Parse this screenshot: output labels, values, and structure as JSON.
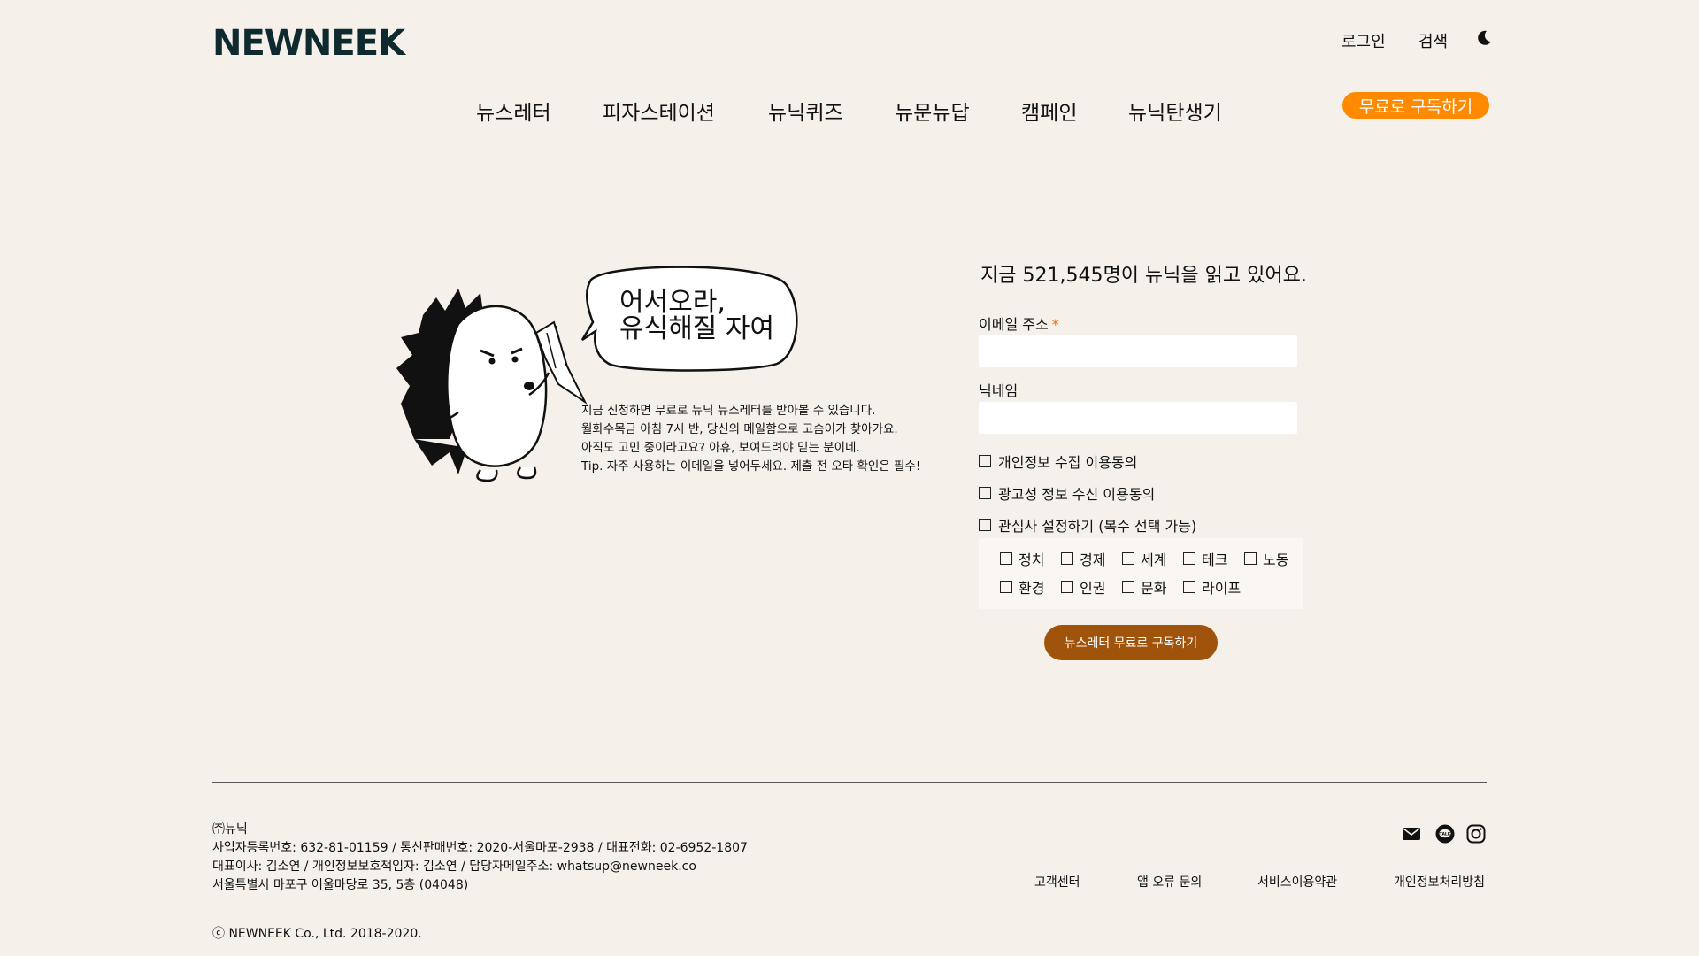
{
  "header": {
    "logo": "NEWNEEK",
    "login": "로그인",
    "search": "검색",
    "theme_icon": "moon-icon",
    "nav": [
      "뉴스레터",
      "피자스테이션",
      "뉴닉퀴즈",
      "뉴문뉴답",
      "캠페인",
      "뉴닉탄생기"
    ],
    "subscribe_button": "무료로 구독하기",
    "accent_color": "#ff8a00"
  },
  "hero": {
    "bubble_text": "어서오라,\n유식해질 자여",
    "intro": [
      "지금 신청하면 무료로 뉴닉 뉴스레터를 받아볼 수 있습니다.",
      "월화수목금 아침 7시 반, 당신의 메일함으로 고슴이가 찾아가요.",
      "아직도 고민 중이라고요? 아휴, 보여드려야 믿는 분이네.",
      "Tip. 자주 사용하는 이메일을 넣어두세요. 제출 전 오타 확인은 필수!"
    ]
  },
  "form": {
    "count_line": "지금  521,545명이 뉴닉을 읽고 있어요.",
    "email_label": "이메일 주소",
    "required_mark": "*",
    "email_value": "",
    "nickname_label": "닉네임",
    "nickname_value": "",
    "privacy_consent": "개인정보 수집 이용동의",
    "ad_consent": "광고성 정보 수신 이용동의",
    "interest_setting": "관심사 설정하기 (복수 선택 가능)",
    "interests": [
      "정치",
      "경제",
      "세계",
      "테크",
      "노동",
      "환경",
      "인권",
      "문화",
      "라이프"
    ],
    "submit": "뉴스레터 무료로 구독하기",
    "submit_color": "#a0540b"
  },
  "footer": {
    "company": "㈜뉴닉",
    "line1": "사업자등록번호: 632-81-01159   /   통신판매번호: 2020-서울마포-2938   /   대표전화: 02-6952-1807",
    "line2": "대표이사: 김소연   /   개인정보보호책임자: 김소연   /   담당자메일주소: whatsup@newneek.co",
    "line3": "서울특별시 마포구 어울마당로 35, 5층 (04048)",
    "copyright": "ⓒ NEWNEEK Co., Ltd. 2018-2020.",
    "links": [
      "고객센터",
      "앱 오류 문의",
      "서비스이용약관",
      "개인정보처리방침"
    ],
    "social_icons": [
      "mail-icon",
      "kakao-talk-icon",
      "instagram-icon"
    ]
  }
}
